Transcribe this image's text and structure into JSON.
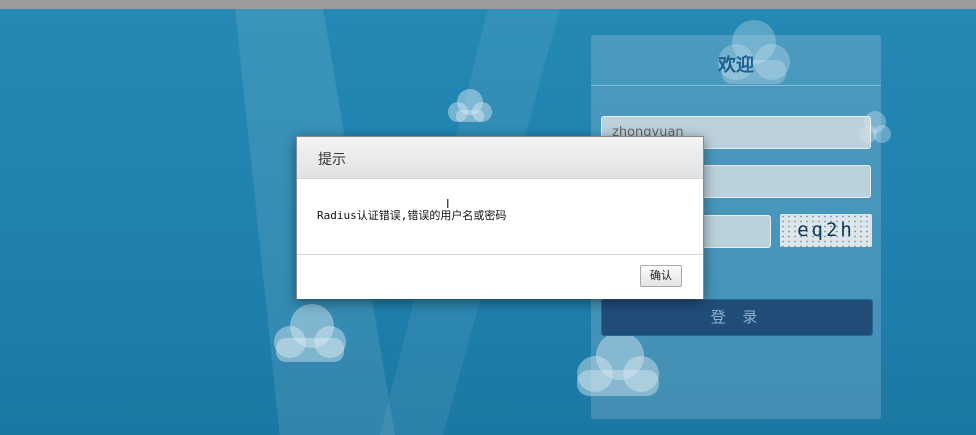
{
  "login": {
    "title": "欢迎",
    "username_value": "zhongyuan",
    "password_value": "",
    "captcha_value": "",
    "captcha_text": "eq2h",
    "login_label": "登 录"
  },
  "dialog": {
    "title": "提示",
    "message": "Radius认证错误,错误的用户名或密码",
    "confirm_label": "确认"
  },
  "colors": {
    "background": "#1f7fab",
    "login_button": "#1f4d78",
    "panel_title": "#1d5f8f"
  },
  "icons": {
    "cloud": "cloud-icon",
    "cursor": "text-cursor-icon"
  }
}
